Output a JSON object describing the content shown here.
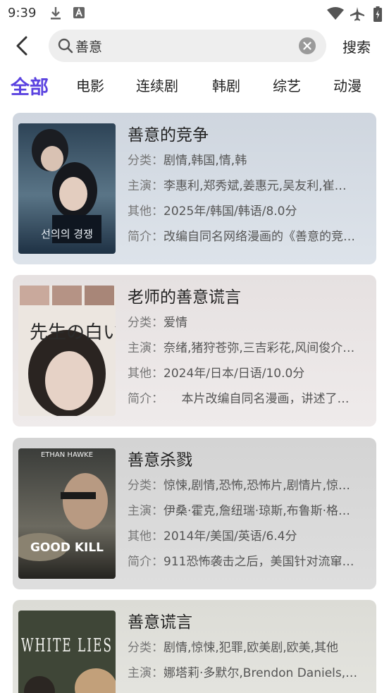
{
  "status_bar": {
    "time": "9:39"
  },
  "search": {
    "query": "善意",
    "button_label": "搜索"
  },
  "tabs": [
    {
      "label": "全部",
      "active": true
    },
    {
      "label": "电影",
      "active": false
    },
    {
      "label": "连续剧",
      "active": false
    },
    {
      "label": "韩剧",
      "active": false
    },
    {
      "label": "综艺",
      "active": false
    },
    {
      "label": "动漫",
      "active": false
    }
  ],
  "colors": {
    "accent": "#5b43e0",
    "label": "#777777",
    "value": "#555555"
  },
  "field_labels": {
    "genre": "分类：",
    "cast": "主演：",
    "other": "其他：",
    "synopsis": "简介："
  },
  "results": [
    {
      "title": "善意的竞争",
      "genre": "剧情,韩国,情,韩",
      "cast": "李惠利,郑秀斌,姜惠元,吴友利,崔…",
      "other": "2025年/韩国/韩语/8.0分",
      "synopsis": "改编自同名网络漫画的《善意的竞…",
      "poster_text": "선의의 경쟁"
    },
    {
      "title": "老师的善意谎言",
      "genre": "爱情",
      "cast": "奈绪,猪狩苍弥,三吉彩花,风间俊介…",
      "other": "2024年/日本/日语/10.0分",
      "synopsis": "　　本片改编自同名漫画，讲述了…",
      "poster_text": "先生の白い嘘"
    },
    {
      "title": "善意杀戮",
      "genre": "惊悚,剧情,恐怖,恐怖片,剧情片,惊…",
      "cast": "伊桑·霍克,詹纽瑞·琼斯,布鲁斯·格…",
      "other": "2014年/美国/英语/6.4分",
      "synopsis": "911恐怖袭击之后，美国针对流窜…",
      "poster_top": "ETHAN HAWKE",
      "poster_text": "GOOD KILL"
    },
    {
      "title": "善意谎言",
      "genre": "剧情,惊悚,犯罪,欧美剧,欧美,其他",
      "cast": "娜塔莉·多默尔,Brendon Daniels,…",
      "poster_text": "WHITE LIES"
    }
  ]
}
